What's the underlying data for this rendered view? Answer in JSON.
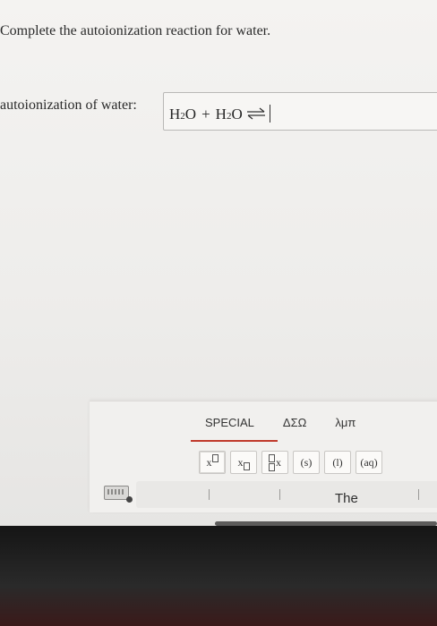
{
  "instruction": "Complete the autoionization reaction for water.",
  "field_label": "autoionization of water:",
  "equation": {
    "h1": "H",
    "sub1": "2",
    "o1": "O",
    "plus": "+",
    "h2": "H",
    "sub2": "2",
    "o2": "O",
    "arrow": "equilibrium-arrows-icon"
  },
  "keyboard": {
    "tabs": [
      "SPECIAL",
      "ΔΣΩ",
      "λμπ"
    ],
    "active_tab": "SPECIAL",
    "keys": {
      "superscript": "x",
      "subscript": "x",
      "isotope": "x",
      "solid": "(s)",
      "liquid": "(l)",
      "aqueous": "(aq)"
    },
    "prediction": "The"
  },
  "colors": {
    "accent": "#c0392b",
    "background": "#efeeec",
    "bezel": "#1c1c1c"
  }
}
